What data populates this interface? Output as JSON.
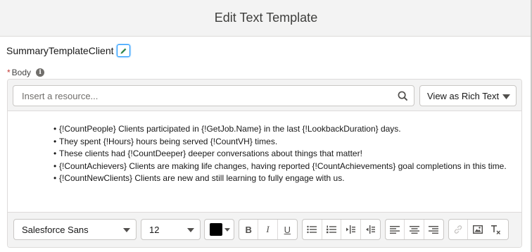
{
  "modal": {
    "title": "Edit Text Template"
  },
  "template": {
    "name": "SummaryTemplateClient"
  },
  "body_field": {
    "label": "Body",
    "required_marker": "*"
  },
  "resource_search": {
    "placeholder": "Insert a resource..."
  },
  "view_select": {
    "value": "View as Rich Text"
  },
  "content": {
    "bullets": [
      "{!CountPeople} Clients participated in {!GetJob.Name} in the last {!LookbackDuration} days.",
      "They spent {!Hours} hours being served {!CountVH} times.",
      "These clients had {!CountDeeper} deeper conversations about things that matter!",
      "{!CountAchievers} Clients are making life changes, having reported {!CountAchievements} goal completions in this time.",
      "{!CountNewClients} Clients are new and still learning to fully engage with us."
    ]
  },
  "toolbar": {
    "font_family": "Salesforce Sans",
    "font_size": "12",
    "text_color": "#000000",
    "bold_label": "B",
    "italic_label": "I",
    "underline_label": "U",
    "icons": [
      "bullet-list-icon",
      "numbered-list-icon",
      "outdent-icon",
      "indent-icon",
      "align-left-icon",
      "align-center-icon",
      "align-right-icon",
      "link-icon",
      "image-icon",
      "clear-format-icon"
    ]
  },
  "colors": {
    "accent": "#1b96ff",
    "required": "#c23934",
    "edit_icon": "#2e844a"
  }
}
